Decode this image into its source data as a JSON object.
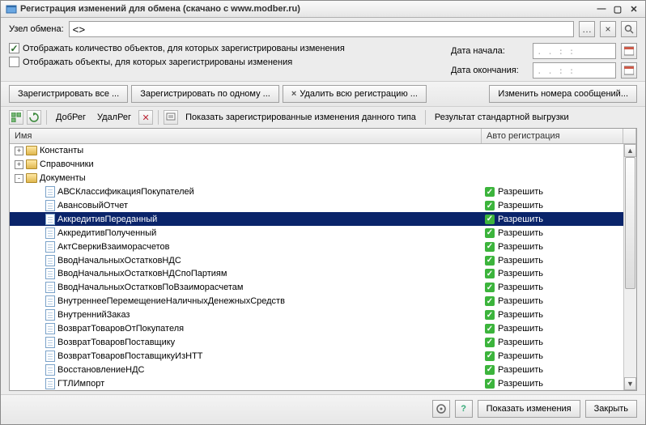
{
  "window": {
    "title": "Регистрация изменений для обмена (скачано с www.modber.ru)"
  },
  "nodeRow": {
    "label": "Узел обмена:",
    "value": "<>"
  },
  "checks": {
    "show_counts": "Отображать количество объектов, для которых зарегистрированы изменения",
    "show_objects": "Отображать объекты, для которых зарегистрированы изменения",
    "date_start_label": "Дата начала:",
    "date_end_label": "Дата окончания:",
    "date_placeholder": ". .   : :"
  },
  "toolbar": {
    "reg_all": "Зарегистрировать все ...",
    "reg_one": "Зарегистрировать по одному ...",
    "del_all": "Удалить всю регистрацию ...",
    "change_nums": "Изменить номера сообщений..."
  },
  "toolbar2": {
    "dobreg": "ДобРег",
    "udalreg": "УдалРег",
    "show_changes": "Показать зарегистрированные изменения данного типа",
    "std_export": "Результат стандартной выгрузки"
  },
  "columns": {
    "name": "Имя",
    "auto": "Авто регистрация"
  },
  "auto_value": "Разрешить",
  "tree": {
    "roots": [
      {
        "label": "Константы",
        "exp": "+"
      },
      {
        "label": "Справочники",
        "exp": "+"
      },
      {
        "label": "Документы",
        "exp": "-",
        "children": [
          "АВСКлассификацияПокупателей",
          "АвансовыйОтчет",
          "АккредитивПереданный",
          "АккредитивПолученный",
          "АктСверкиВзаиморасчетов",
          "ВводНачальныхОстатковНДС",
          "ВводНачальныхОстатковНДСпоПартиям",
          "ВводНачальныхОстатковПоВзаиморасчетам",
          "ВнутреннееПеремещениеНаличныхДенежныхСредств",
          "ВнутреннийЗаказ",
          "ВозвратТоваровОтПокупателя",
          "ВозвратТоваровПоставщику",
          "ВозвратТоваровПоставщикуИзНТТ",
          "ВосстановлениеНДС",
          "ГТЛИмпорт"
        ]
      }
    ],
    "selected_child_index": 2
  },
  "footer": {
    "show_changes": "Показать изменения",
    "close": "Закрыть"
  }
}
